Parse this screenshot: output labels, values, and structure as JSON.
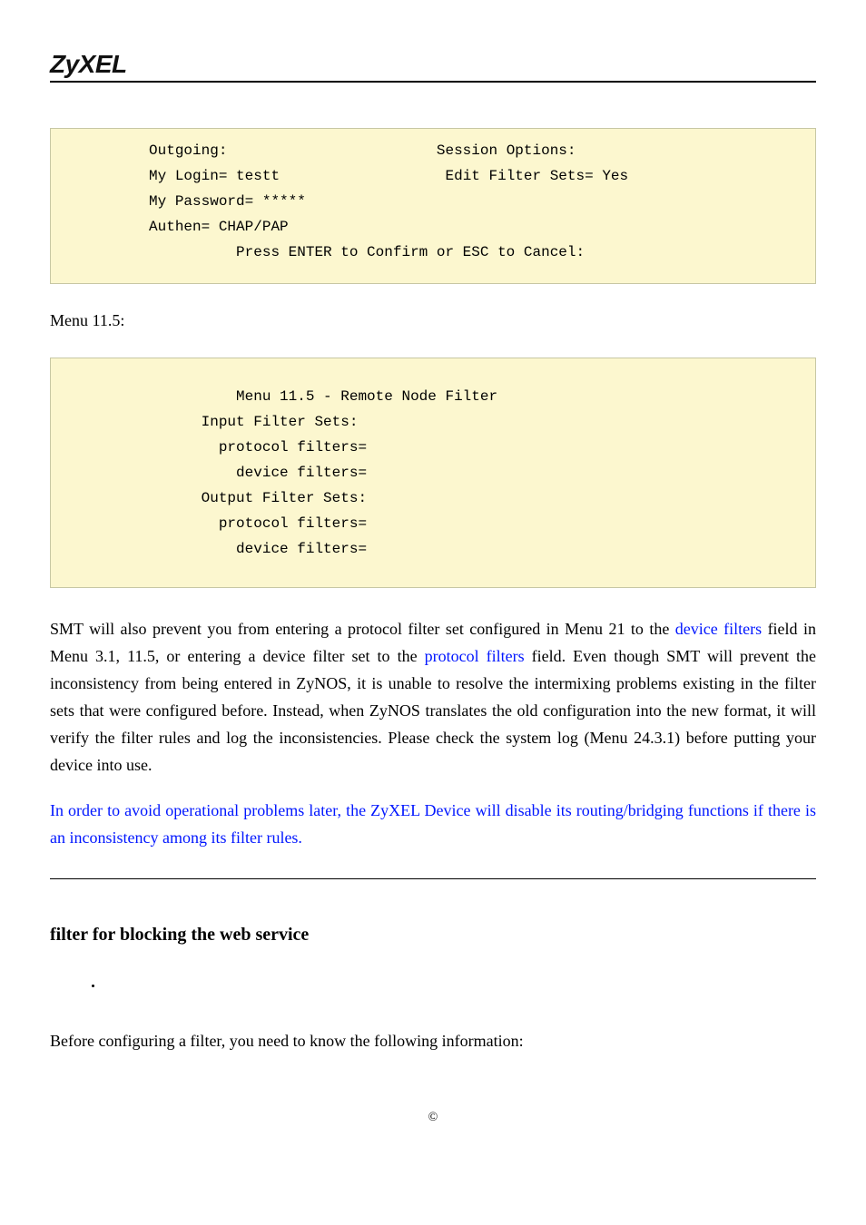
{
  "brand": "ZyXEL",
  "codebox1": {
    "line1_left": "Outgoing:",
    "line1_right": "Session Options:",
    "line2_left": "My Login= testt",
    "line2_right": "Edit Filter Sets= Yes",
    "line3": "My Password= *****",
    "line4": "Authen= CHAP/PAP",
    "line5": "Press ENTER to Confirm or ESC to Cancel:"
  },
  "caption1": "Menu 11.5:",
  "codebox2": {
    "line1": "Menu 11.5 - Remote Node Filter",
    "line2": "Input Filter Sets:",
    "line3": "protocol filters=",
    "line4": "device filters=",
    "line5": "Output Filter Sets:",
    "line6": "protocol filters=",
    "line7": "device filters="
  },
  "para1": {
    "t1": "SMT will also prevent you from entering a protocol filter set configured in Menu 21 to the ",
    "df": "device filters",
    "t2": " field in Menu 3.1, 11.5, or entering a device filter set to the ",
    "pf": "protocol filters",
    "t3": " field. Even though SMT will prevent the inconsistency from being entered in ZyNOS, it is unable to resolve the intermixing problems existing in the filter sets that were configured before. Instead, when ZyNOS translates the old configuration into the new format, it will verify the filter rules and log the inconsistencies. Please check the system log (Menu 24.3.1) before putting your device into use."
  },
  "para2": "In order to avoid operational problems later, the ZyXEL Device will disable its routing/bridging functions if there is an inconsistency among its filter rules.",
  "section_title": "filter for blocking the web service",
  "para3": "Before configuring a filter, you need to know the following information:",
  "copyright": "©"
}
